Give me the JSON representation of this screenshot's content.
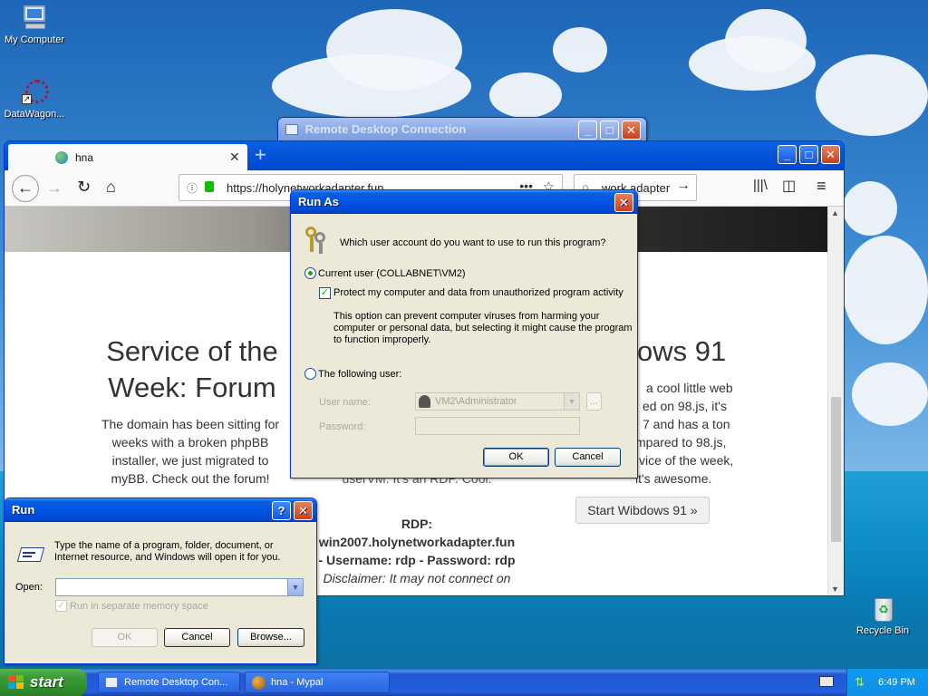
{
  "desktop": {
    "icons": [
      {
        "label": "My Computer"
      },
      {
        "label": "DataWagon..."
      },
      {
        "label": "Recycle Bin"
      }
    ]
  },
  "rdp_window": {
    "title": "Remote Desktop Connection"
  },
  "browser": {
    "tab_title": "hna",
    "new_tab": "+",
    "url": "https://holynetworkadapter.fun",
    "search_value": "work adapter",
    "content": {
      "left_title_line1": "Service of the",
      "left_title_line2": "Week: Forum",
      "left_text": [
        "The domain has been sitting for",
        "weeks with a broken phpBB",
        "installer, we just migrated to",
        "myBB. Check out the forum!"
      ],
      "right_title": "ows 91",
      "right_text": [
        "a cool little web",
        "ed on 98.js, it's",
        "7 and has a ton",
        "mpared to 98.js,",
        "vice of the week,",
        "it's awesome."
      ],
      "right_button": "Start Wibdows 91 »",
      "center_fragment": "userVM. It's an RDP. Cool.",
      "rdp_label": "RDP:",
      "rdp_host": "win2007.holynetworkadapter.fun",
      "rdp_creds": "- Username: rdp - Password: rdp",
      "disclaimer": "Disclaimer: It may not connect on"
    }
  },
  "runas": {
    "title": "Run As",
    "question": "Which user account do you want to use to run this program?",
    "current_user_label": "Current user (COLLABNET\\VM2)",
    "protect_label": "Protect my computer and data from unauthorized program activity",
    "protect_desc": [
      "This option can prevent computer viruses from harming your",
      "computer or personal data, but selecting it might cause the program",
      "to function improperly."
    ],
    "following_user_label": "The following user:",
    "username_label": "User name:",
    "username_value": "VM2\\Administrator",
    "browse_label": "...",
    "password_label": "Password:",
    "ok": "OK",
    "cancel": "Cancel"
  },
  "run": {
    "title": "Run",
    "help": "?",
    "description": [
      "Type the name of a program, folder, document, or",
      "Internet resource, and Windows will open it for you."
    ],
    "open_label": "Open:",
    "open_value": "",
    "separate_memory": "Run in separate memory space",
    "ok": "OK",
    "cancel": "Cancel",
    "browse": "Browse..."
  },
  "taskbar": {
    "start": "start",
    "items": [
      {
        "label": "Remote Desktop Con..."
      },
      {
        "label": "hna - Mypal"
      }
    ],
    "clock": "6:49 PM"
  },
  "colors": {
    "xp_blue": "#0055e5",
    "start_green": "#3c9a3a",
    "close_red": "#c5411b"
  }
}
